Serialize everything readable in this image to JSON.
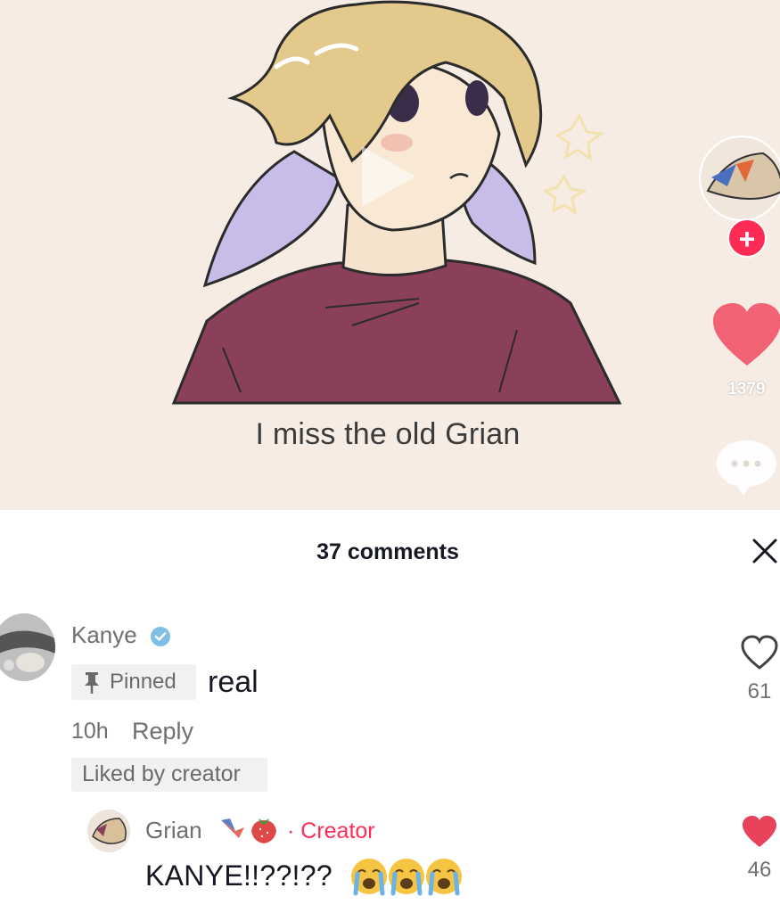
{
  "video": {
    "caption": "I miss the old Grian",
    "like_count": "1379",
    "follow_symbol": "+",
    "background_color": "#f7ece3"
  },
  "comments_sheet": {
    "title": "37 comments",
    "close_icon": "close-icon"
  },
  "comment": {
    "author": "Kanye",
    "pinned_label": "Pinned",
    "text": "real",
    "time": "10h",
    "reply_label": "Reply",
    "liked_by_creator_label": "Liked by creator",
    "like_count": "61"
  },
  "reply": {
    "author": "Grian",
    "creator_label": "· Creator",
    "text": "KANYE!!??!??",
    "like_count": "46"
  },
  "colors": {
    "accent": "#fe2c55",
    "muted_text": "#6f6f6f",
    "verified": "#20d5ec"
  }
}
